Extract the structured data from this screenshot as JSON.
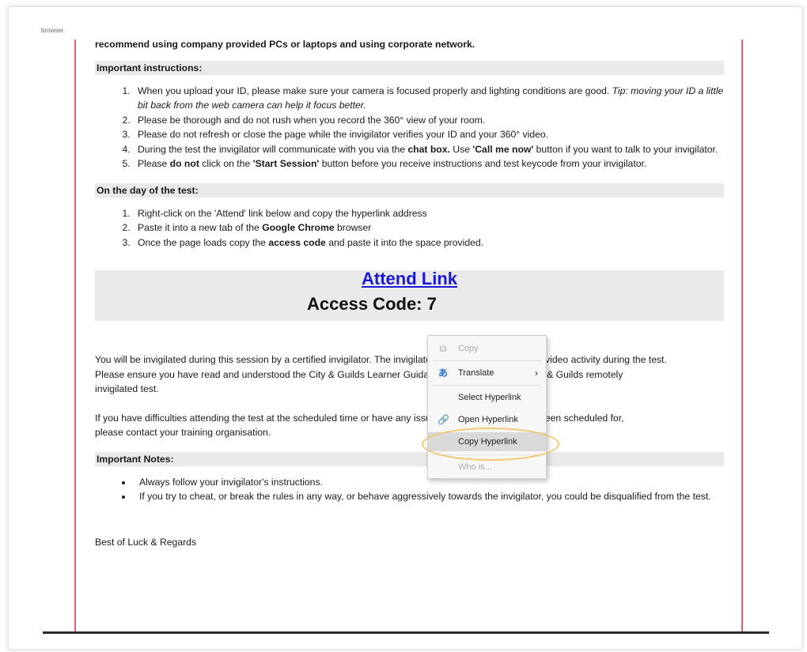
{
  "stray_text": "browser.",
  "intro_line": "recommend using company provided PCs or laptops and using corporate network.",
  "important_instructions": {
    "heading": "Important instructions:",
    "items": [
      {
        "prefix": "When you upload your ID, please make sure your camera is focused properly and lighting conditions are good. ",
        "italic": "Tip: moving your ID a little bit back from the web camera can help it focus better."
      },
      {
        "text": "Please be thorough and do not rush when you record the 360° view of your room."
      },
      {
        "text": "Please do not refresh or close the page while the invigilator verifies your ID and your 360° video."
      },
      {
        "a": "During the test the invigilator will communicate with you via the ",
        "b": "chat box.",
        "c": " Use ",
        "d": "'Call me now'",
        "e": " button if you want to talk to your invigilator."
      },
      {
        "a": "Please ",
        "b": "do not",
        "c": " click on the ",
        "d": "'Start Session'",
        "e": " button before you receive instructions and test keycode from your invigilator."
      }
    ]
  },
  "day_of_test": {
    "heading": "On the day of the test:",
    "items": [
      {
        "text": "Right-click on the 'Attend' link below and copy the hyperlink address"
      },
      {
        "a": "Paste it into a new tab of the ",
        "b": "Google Chrome",
        "c": " browser"
      },
      {
        "a": "Once the page loads copy the ",
        "b": "access code",
        "c": " and paste it into the space provided."
      }
    ]
  },
  "attend_link": "Attend Link",
  "access_code": "Access Code: 7",
  "para1_line1": "You will be invigilated during this session by a certified invigilator. The invigilator will monitor all audio and video activity during the test.",
  "para1_line2": "Please ensure you have read and understood the City & Guilds Learner Guidance before attending a City & Guilds remotely",
  "para1_line3": "invigilated test.",
  "para2_line1": "If you have difficulties attending the test at the scheduled time or have any issues with the test you have been scheduled for,",
  "para2_line2": "please contact your training organisation.",
  "important_notes": {
    "heading": "Important Notes:",
    "items": [
      "Always follow your invigilator's instructions.",
      "If you try to cheat, or break the rules in any way, or behave aggressively towards the invigilator, you could be disqualified from the test."
    ]
  },
  "closing": "Best of Luck & Regards",
  "context_menu": {
    "copy": "Copy",
    "translate": "Translate",
    "select_hyperlink": "Select Hyperlink",
    "open_hyperlink": "Open Hyperlink",
    "copy_hyperlink": "Copy Hyperlink",
    "who_is": "Who is..."
  },
  "colors": {
    "link": "#1a1ad6",
    "margin_line": "#e36470",
    "highlight_ring": "#f0c872"
  }
}
